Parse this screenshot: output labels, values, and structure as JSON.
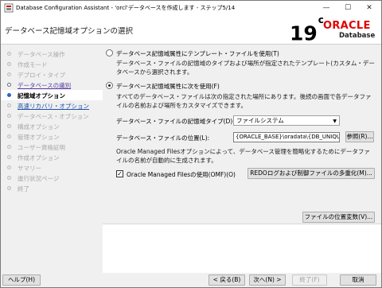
{
  "window": {
    "title": "Database Configuration Assistant - 'orcl'データベースを作成します - ステップ5/14",
    "min_glyph": "—",
    "max_glyph": "☐",
    "close_glyph": "✕"
  },
  "header": {
    "page_title": "データベース記憶域オプションの選択",
    "brand_version": "19",
    "brand_version_sup": "c",
    "brand_name": "ORACLE",
    "brand_sub": "Database"
  },
  "sidebar": {
    "steps": [
      {
        "label": "データベース操作",
        "state": "done"
      },
      {
        "label": "作成モード",
        "state": "done"
      },
      {
        "label": "デプロイ・タイプ",
        "state": "done"
      },
      {
        "label": "データベースの識別",
        "state": "link"
      },
      {
        "label": "記憶域オプション",
        "state": "active"
      },
      {
        "label": "高速リカバリ・オプション",
        "state": "next-link"
      },
      {
        "label": "データベース・オプション",
        "state": "pending"
      },
      {
        "label": "構成オプション",
        "state": "pending"
      },
      {
        "label": "管理オプション",
        "state": "pending"
      },
      {
        "label": "ユーザー資格証明",
        "state": "pending"
      },
      {
        "label": "作成オプション",
        "state": "pending"
      },
      {
        "label": "サマリー",
        "state": "pending"
      },
      {
        "label": "進行状況ページ",
        "state": "pending"
      },
      {
        "label": "終了",
        "state": "pending"
      }
    ]
  },
  "content": {
    "option_template_label": "データベース記憶域属性にテンプレート・ファイルを使用(T)",
    "option_template_desc": "データベース・ファイルの記憶域のタイプおよび場所が指定されたテンプレート(カスタム・データベースから選択されます。",
    "option_custom_label": "データベース記憶域属性に次を使用(F)",
    "option_custom_desc": "すべてのデータベース・ファイルは次の指定された場所にあります。後続の画面で各データファイルの名前および場所をカスタマイズできます。",
    "storage_type_label": "データベース・ファイルの記憶域タイプ(D):",
    "storage_type_value": "ファイルシステム",
    "file_location_label": "データベース・ファイルの位置(L):",
    "file_location_value": "{ORACLE_BASE}\\oradata\\{DB_UNIQU",
    "browse_button": "参照(R)...",
    "omf_desc": "Oracle Managed Filesオプションによって、データベース管理を簡略化するためにデータファイルの名前が自動的に生成されます。",
    "omf_checkbox_label": "Oracle Managed Filesの使用(OMF)(O)",
    "omf_checked": true,
    "multiplex_button": "REDOログおよび制御ファイルの多重化(M)...",
    "file_location_vars_button": "ファイルの位置変数(V)..."
  },
  "footer": {
    "help_button": "ヘルプ(H)",
    "back_button": "< 戻る(B)",
    "next_button": "次へ(N) >",
    "finish_button": "終了(F)",
    "cancel_button": "取消"
  },
  "colors": {
    "oracle_red": "#e00000",
    "active_dot": "#2d64c4",
    "link_purple": "#5a3ea5"
  }
}
